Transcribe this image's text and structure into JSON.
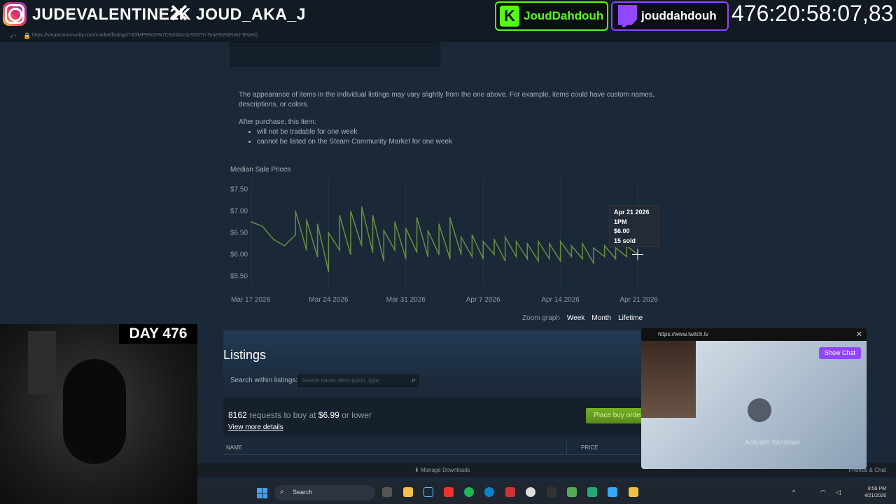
{
  "overlay": {
    "instagram_handle": "JUDEVALENTINE2K",
    "x_handle": "JOUD_AKA_J",
    "kick_handle": "JoudDahdouh",
    "twitch_handle": "jouddahdouh",
    "timer": "476:20:58:07,83",
    "day_label": "DAY 476"
  },
  "browser": {
    "url": "https://steamcommunity.com/market/listings/730/MP9%20%7C%20Arctic%20Tri-Tone%20(Field-Tested)"
  },
  "item": {
    "note": "The appearance of items in the individual listings may vary slightly from the one above. For example, items could have custom names, descriptions, or colors.",
    "after_purchase": "After purchase, this item:",
    "bullets": [
      "will not be tradable for one week",
      "cannot be listed on the Steam Community Market for one week"
    ]
  },
  "chart_data": {
    "type": "line",
    "title": "Median Sale Prices",
    "yticks": [
      "$7.50",
      "$7.00",
      "$6.50",
      "$6.00",
      "$5.50"
    ],
    "ylim": [
      5.25,
      7.75
    ],
    "xticks": [
      "Mar 17 2026",
      "Mar 24 2026",
      "Mar 31 2026",
      "Apr 7 2026",
      "Apr 14 2026",
      "Apr 21 2026"
    ],
    "x_dates": [
      "2026-03-17",
      "2026-03-24",
      "2026-03-31",
      "2026-04-07",
      "2026-04-14",
      "2026-04-21"
    ],
    "grid": true,
    "series": [
      {
        "color": "#688f3e",
        "points": [
          [
            "2026-03-17",
            6.75
          ],
          [
            "2026-03-18",
            6.65
          ],
          [
            "2026-03-19",
            6.35
          ],
          [
            "2026-03-20",
            6.2
          ],
          [
            "2026-03-21",
            6.45
          ],
          [
            "2026-03-21",
            7.0
          ],
          [
            "2026-03-22",
            6.1
          ],
          [
            "2026-03-22",
            6.8
          ],
          [
            "2026-03-23",
            5.95
          ],
          [
            "2026-03-23",
            6.7
          ],
          [
            "2026-03-24",
            5.6
          ],
          [
            "2026-03-24",
            6.5
          ],
          [
            "2026-03-25",
            6.1
          ],
          [
            "2026-03-25",
            6.9
          ],
          [
            "2026-03-26",
            6.0
          ],
          [
            "2026-03-26",
            7.0
          ],
          [
            "2026-03-27",
            6.2
          ],
          [
            "2026-03-27",
            7.1
          ],
          [
            "2026-03-28",
            6.05
          ],
          [
            "2026-03-28",
            6.9
          ],
          [
            "2026-03-29",
            5.85
          ],
          [
            "2026-03-29",
            6.55
          ],
          [
            "2026-03-30",
            6.1
          ],
          [
            "2026-03-30",
            6.75
          ],
          [
            "2026-03-31",
            5.9
          ],
          [
            "2026-03-31",
            6.6
          ],
          [
            "2026-04-01",
            6.05
          ],
          [
            "2026-04-01",
            6.85
          ],
          [
            "2026-04-02",
            5.95
          ],
          [
            "2026-04-02",
            6.55
          ],
          [
            "2026-04-03",
            6.0
          ],
          [
            "2026-04-03",
            6.7
          ],
          [
            "2026-04-04",
            5.9
          ],
          [
            "2026-04-04",
            6.85
          ],
          [
            "2026-04-05",
            6.0
          ],
          [
            "2026-04-05",
            6.4
          ],
          [
            "2026-04-06",
            5.95
          ],
          [
            "2026-04-06",
            6.45
          ],
          [
            "2026-04-07",
            5.9
          ],
          [
            "2026-04-07",
            6.3
          ],
          [
            "2026-04-08",
            6.0
          ],
          [
            "2026-04-08",
            6.35
          ],
          [
            "2026-04-09",
            5.85
          ],
          [
            "2026-04-09",
            6.4
          ],
          [
            "2026-04-10",
            5.95
          ],
          [
            "2026-04-10",
            6.3
          ],
          [
            "2026-04-11",
            5.9
          ],
          [
            "2026-04-11",
            6.25
          ],
          [
            "2026-04-12",
            5.85
          ],
          [
            "2026-04-12",
            6.3
          ],
          [
            "2026-04-13",
            5.9
          ],
          [
            "2026-04-13",
            6.25
          ],
          [
            "2026-04-14",
            5.85
          ],
          [
            "2026-04-14",
            6.3
          ],
          [
            "2026-04-15",
            5.95
          ],
          [
            "2026-04-15",
            6.2
          ],
          [
            "2026-04-16",
            5.9
          ],
          [
            "2026-04-16",
            6.25
          ],
          [
            "2026-04-17",
            5.8
          ],
          [
            "2026-04-17",
            6.15
          ],
          [
            "2026-04-18",
            5.95
          ],
          [
            "2026-04-18",
            6.2
          ],
          [
            "2026-04-19",
            5.9
          ],
          [
            "2026-04-19",
            6.15
          ],
          [
            "2026-04-20",
            5.95
          ],
          [
            "2026-04-20",
            6.2
          ],
          [
            "2026-04-21",
            6.0
          ]
        ]
      }
    ],
    "tooltip": {
      "date": "Apr 21 2026",
      "time": "1PM",
      "price": "$6.00",
      "sold": "15 sold"
    }
  },
  "zoom": {
    "label": "Zoom graph",
    "options": [
      "Week",
      "Month",
      "Lifetime"
    ]
  },
  "listings": {
    "title": "Listings",
    "search_label": "Search within listings:",
    "search_placeholder": "Search name, description, type",
    "requests_count": "8162",
    "requests_text": "requests to buy at",
    "requests_price": "$6.99",
    "requests_suffix": "or lower",
    "view_more": "View more details",
    "place_order": "Place buy order",
    "col_name": "NAME",
    "col_price": "PRICE"
  },
  "steam_bar": {
    "manage_downloads": "Manage Downloads",
    "friends": "Friends & Chat"
  },
  "pip": {
    "url": "https://www.twitch.tv",
    "show_chat": "Show Chat",
    "watermark": "Activate Windows"
  },
  "taskbar": {
    "search": "Search",
    "time": "8:59 PM",
    "date": "4/21/2026"
  }
}
